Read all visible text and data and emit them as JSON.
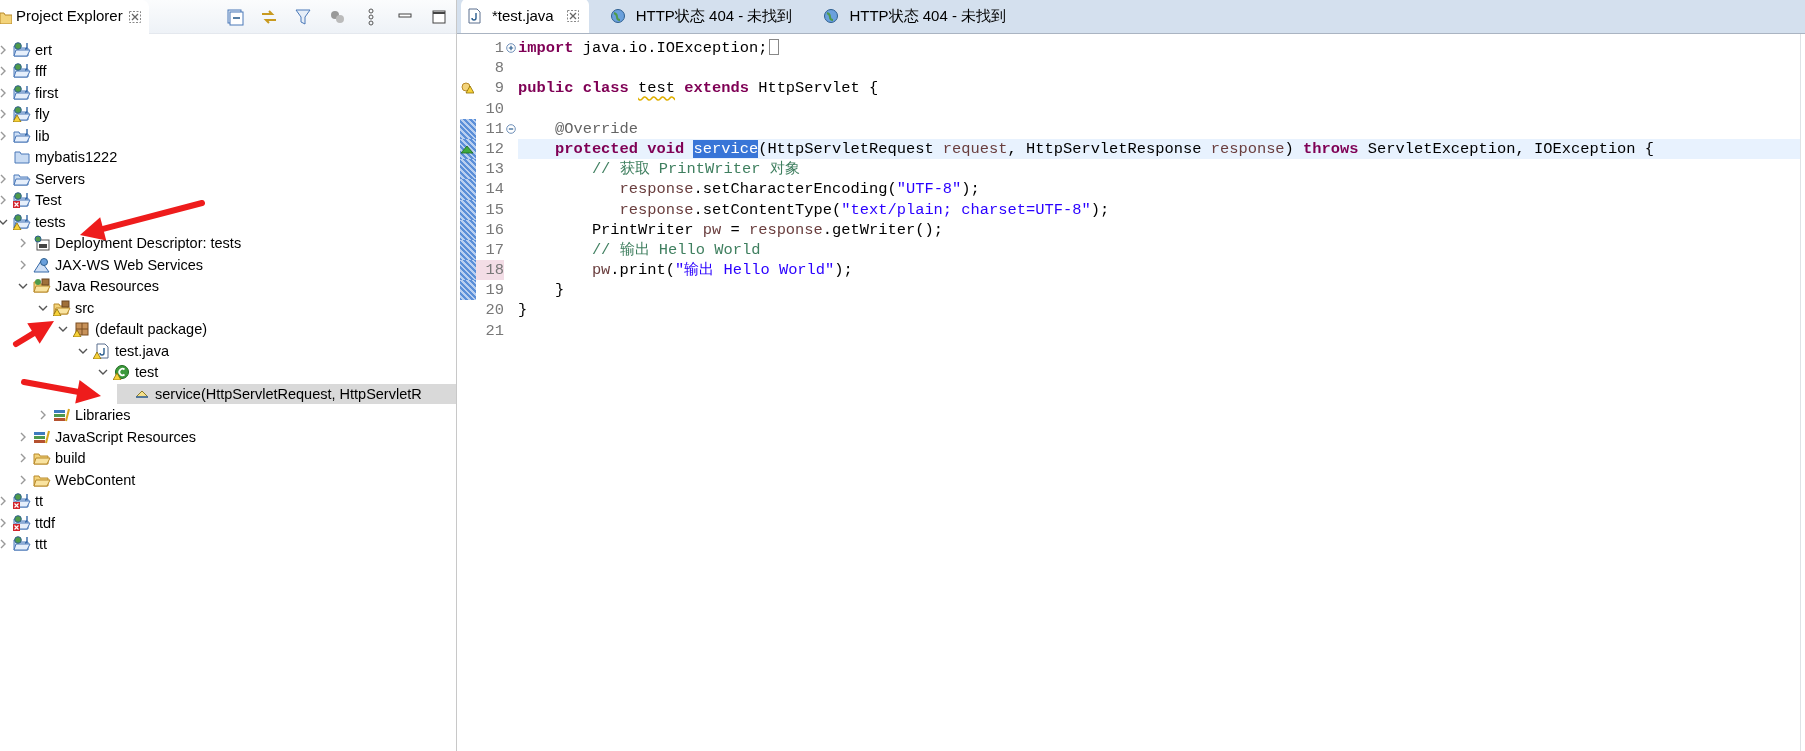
{
  "project_explorer": {
    "title": "Project Explorer",
    "items": [
      {
        "label": "ert",
        "kind": "project",
        "warning": false,
        "error": false,
        "expanded": false,
        "selected": false
      },
      {
        "label": "fff",
        "kind": "project",
        "warning": false,
        "error": false,
        "expanded": false,
        "selected": false
      },
      {
        "label": "first",
        "kind": "project",
        "warning": false,
        "error": false,
        "expanded": false,
        "selected": false
      },
      {
        "label": "fly",
        "kind": "project",
        "warning": true,
        "error": false,
        "expanded": false,
        "selected": false
      },
      {
        "label": "lib",
        "kind": "library-project",
        "warning": false,
        "error": false,
        "expanded": false,
        "selected": false
      },
      {
        "label": "mybatis1222",
        "kind": "closed",
        "warning": false,
        "error": false,
        "selected": false
      },
      {
        "label": "Servers",
        "kind": "servers",
        "warning": false,
        "error": false,
        "expanded": false,
        "selected": false
      },
      {
        "label": "Test",
        "kind": "project",
        "warning": false,
        "error": true,
        "expanded": false,
        "selected": false
      },
      {
        "label": "tests",
        "kind": "project",
        "warning": true,
        "error": false,
        "expanded": true,
        "selected": false,
        "children": [
          {
            "label": "Deployment Descriptor: tests",
            "kind": "descriptor",
            "warning": false,
            "error": false,
            "expanded": false,
            "selected": false
          },
          {
            "label": "JAX-WS Web Services",
            "kind": "webservice",
            "warning": false,
            "error": false,
            "expanded": false,
            "selected": false
          },
          {
            "label": "Java Resources",
            "kind": "resources",
            "warning": false,
            "error": false,
            "expanded": true,
            "selected": false,
            "children": [
              {
                "label": "src",
                "kind": "source",
                "warning": true,
                "error": false,
                "expanded": true,
                "selected": false,
                "children": [
                  {
                    "label": "(default package)",
                    "kind": "package",
                    "warning": true,
                    "error": false,
                    "expanded": true,
                    "selected": false,
                    "children": [
                      {
                        "label": "test.java",
                        "kind": "java",
                        "warning": true,
                        "error": false,
                        "expanded": true,
                        "selected": false,
                        "children": [
                          {
                            "label": "test",
                            "kind": "class",
                            "warning": true,
                            "error": false,
                            "expanded": true,
                            "selected": false,
                            "children": [
                              {
                                "label": "service(HttpServletRequest, HttpServletR",
                                "kind": "method",
                                "warning": false,
                                "error": false,
                                "selected": true
                              }
                            ]
                          }
                        ]
                      }
                    ]
                  }
                ]
              },
              {
                "label": "Libraries",
                "kind": "library",
                "warning": false,
                "error": false,
                "expanded": false,
                "selected": false
              }
            ]
          },
          {
            "label": "JavaScript Resources",
            "kind": "library",
            "warning": false,
            "error": false,
            "expanded": false,
            "selected": false
          },
          {
            "label": "build",
            "kind": "folder",
            "warning": false,
            "error": false,
            "expanded": false,
            "selected": false
          },
          {
            "label": "WebContent",
            "kind": "folder",
            "warning": false,
            "error": false,
            "expanded": false,
            "selected": false
          }
        ]
      },
      {
        "label": "tt",
        "kind": "project",
        "warning": false,
        "error": true,
        "expanded": false,
        "selected": false
      },
      {
        "label": "ttdf",
        "kind": "project",
        "warning": false,
        "error": true,
        "expanded": false,
        "selected": false
      },
      {
        "label": "ttt",
        "kind": "project",
        "warning": false,
        "error": false,
        "expanded": false,
        "selected": false
      }
    ]
  },
  "editor": {
    "tabs": [
      {
        "label": "*test.java",
        "kind": "java",
        "selected": true
      },
      {
        "label": "HTTP状态 404 - 未找到",
        "kind": "web",
        "selected": false
      },
      {
        "label": "HTTP状态 404 - 未找到",
        "kind": "web",
        "selected": false
      }
    ],
    "lines": [
      {
        "number": "1",
        "kind": "folded",
        "current": false,
        "changed": false,
        "highlighted": false,
        "tokens": [
          {
            "kind": "keyword",
            "text": "import"
          },
          {
            "kind": "plain",
            "text": " java.io.IOException;"
          }
        ]
      },
      {
        "number": "8",
        "kind": "plain",
        "current": false,
        "changed": false,
        "highlighted": false
      },
      {
        "number": "9",
        "kind": "warning",
        "current": false,
        "changed": false,
        "highlighted": false,
        "tokens": [
          {
            "kind": "keyword",
            "text": "public class "
          },
          {
            "kind": "warned",
            "text": "test"
          },
          {
            "kind": "keyword",
            "text": " extends"
          },
          {
            "kind": "plain",
            "text": " HttpServlet {"
          }
        ]
      },
      {
        "number": "10",
        "kind": "plain",
        "current": false,
        "changed": false,
        "highlighted": false
      },
      {
        "number": "11",
        "kind": "fold-start",
        "current": false,
        "changed": true,
        "highlighted": false,
        "tokens": [
          {
            "kind": "annotation",
            "text": "    @Override"
          }
        ]
      },
      {
        "number": "12",
        "kind": "override",
        "current": true,
        "changed": true,
        "highlighted": false,
        "tokens": [
          {
            "kind": "keyword",
            "text": "    protected void "
          },
          {
            "kind": "selection",
            "text": "service"
          },
          {
            "kind": "plain",
            "text": "(HttpServletRequest "
          },
          {
            "kind": "variable",
            "text": "request"
          },
          {
            "kind": "plain",
            "text": ", HttpServletResponse "
          },
          {
            "kind": "variable",
            "text": "response"
          },
          {
            "kind": "plain",
            "text": ") "
          },
          {
            "kind": "keyword",
            "text": "throws"
          },
          {
            "kind": "plain",
            "text": " ServletException, IOException {"
          }
        ]
      },
      {
        "number": "13",
        "kind": "plain",
        "current": false,
        "changed": true,
        "highlighted": false,
        "tokens": [
          {
            "kind": "comment",
            "text": "        // 获取 PrintWriter 对象"
          }
        ]
      },
      {
        "number": "14",
        "kind": "plain",
        "current": false,
        "changed": true,
        "highlighted": false,
        "tokens": [
          {
            "kind": "variable",
            "text": "           response"
          },
          {
            "kind": "plain",
            "text": ".setCharacterEncoding("
          },
          {
            "kind": "string",
            "text": "\"UTF-8\""
          },
          {
            "kind": "plain",
            "text": ");"
          }
        ]
      },
      {
        "number": "15",
        "kind": "plain",
        "current": false,
        "changed": true,
        "highlighted": false,
        "tokens": [
          {
            "kind": "variable",
            "text": "           response"
          },
          {
            "kind": "plain",
            "text": ".setContentType("
          },
          {
            "kind": "string",
            "text": "\"text/plain; charset=UTF-8\""
          },
          {
            "kind": "plain",
            "text": ");"
          }
        ]
      },
      {
        "number": "16",
        "kind": "plain",
        "current": false,
        "changed": true,
        "highlighted": false,
        "tokens": [
          {
            "kind": "plain",
            "text": "        PrintWriter "
          },
          {
            "kind": "variable",
            "text": "pw"
          },
          {
            "kind": "plain",
            "text": " = "
          },
          {
            "kind": "variable",
            "text": "response"
          },
          {
            "kind": "plain",
            "text": ".getWriter();"
          }
        ]
      },
      {
        "number": "17",
        "kind": "plain",
        "current": false,
        "changed": true,
        "highlighted": false,
        "tokens": [
          {
            "kind": "comment",
            "text": "        // 输出 Hello World"
          }
        ]
      },
      {
        "number": "18",
        "kind": "plain",
        "current": false,
        "changed": true,
        "highlighted": true,
        "tokens": [
          {
            "kind": "variable",
            "text": "        pw"
          },
          {
            "kind": "plain",
            "text": ".print("
          },
          {
            "kind": "string",
            "text": "\"输出 Hello World\""
          },
          {
            "kind": "plain",
            "text": ");"
          }
        ]
      },
      {
        "number": "19",
        "kind": "plain",
        "current": false,
        "changed": true,
        "highlighted": false,
        "tokens": [
          {
            "kind": "plain",
            "text": "    }"
          }
        ]
      },
      {
        "number": "20",
        "kind": "plain",
        "current": false,
        "changed": false,
        "highlighted": false,
        "tokens": [
          {
            "kind": "plain",
            "text": "}"
          }
        ]
      },
      {
        "number": "21",
        "kind": "plain",
        "current": false,
        "changed": false,
        "highlighted": false
      }
    ]
  }
}
